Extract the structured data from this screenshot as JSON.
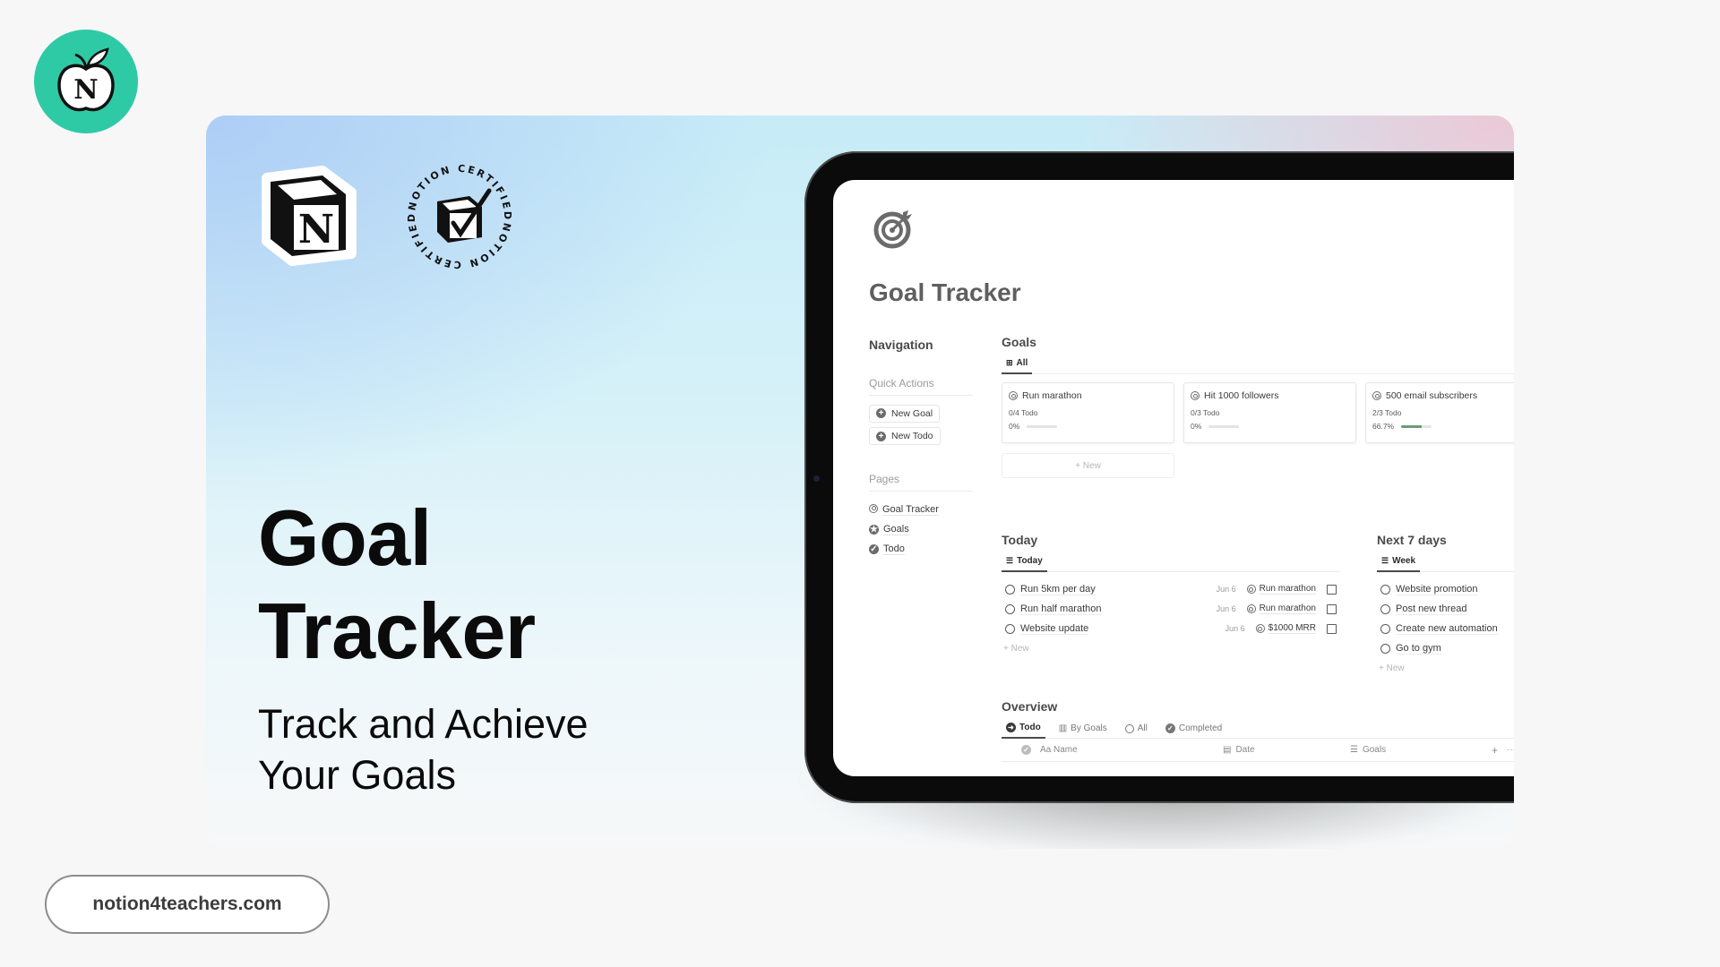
{
  "brand": {
    "logo_letter": "N",
    "accent_color": "#2ecaa5"
  },
  "hero": {
    "title_line1": "Goal",
    "title_line2": "Tracker",
    "subtitle_line1": "Track and Achieve",
    "subtitle_line2": "Your Goals",
    "notion_logo_letter": "N",
    "badge_text": "NOTION CERTIFIED"
  },
  "app": {
    "page_title": "Goal Tracker",
    "navigation": {
      "heading": "Navigation",
      "quick_actions_label": "Quick Actions",
      "quick_actions": [
        {
          "label": "New Goal"
        },
        {
          "label": "New Todo"
        }
      ],
      "pages_label": "Pages",
      "pages": [
        {
          "label": "Goal Tracker",
          "icon": "target-arrow-icon"
        },
        {
          "label": "Goals",
          "icon": "star-circle-icon"
        },
        {
          "label": "Todo",
          "icon": "check-circle-icon"
        }
      ]
    },
    "goals": {
      "title": "Goals",
      "tab": "All",
      "cards": [
        {
          "title": "Run marathon",
          "todo": "0/4 Todo",
          "percent_label": "0%",
          "progress": 0
        },
        {
          "title": "Hit 1000 followers",
          "todo": "0/3 Todo",
          "percent_label": "0%",
          "progress": 0
        },
        {
          "title": "500 email subscribers",
          "todo": "2/3 Todo",
          "percent_label": "66.7%",
          "progress": 0.667
        }
      ],
      "new_label": "+ New"
    },
    "today": {
      "title": "Today",
      "tab": "Today",
      "rows": [
        {
          "name": "Run 5km per day",
          "date": "Jun 6",
          "goal": "Run marathon"
        },
        {
          "name": "Run half marathon",
          "date": "Jun 6",
          "goal": "Run marathon"
        },
        {
          "name": "Website update",
          "date": "Jun 6",
          "goal": "$1000 MRR"
        }
      ],
      "new_label": "+ New"
    },
    "next7": {
      "title": "Next 7 days",
      "tab": "Week",
      "rows": [
        {
          "name": "Website promotion"
        },
        {
          "name": "Post new thread"
        },
        {
          "name": "Create new automation"
        },
        {
          "name": "Go to gym"
        }
      ],
      "new_label": "+ New"
    },
    "overview": {
      "title": "Overview",
      "tabs": [
        "Todo",
        "By Goals",
        "All",
        "Completed"
      ],
      "columns": [
        "Aa Name",
        "Date",
        "Goals"
      ],
      "add_label": "+",
      "more_label": "···"
    }
  },
  "footer": {
    "url": "notion4teachers.com"
  },
  "colors": {
    "progress_fill": "#6b9c7a",
    "card_gradient_blue": "#aecdf6",
    "card_gradient_pink": "#f0c4d2"
  }
}
